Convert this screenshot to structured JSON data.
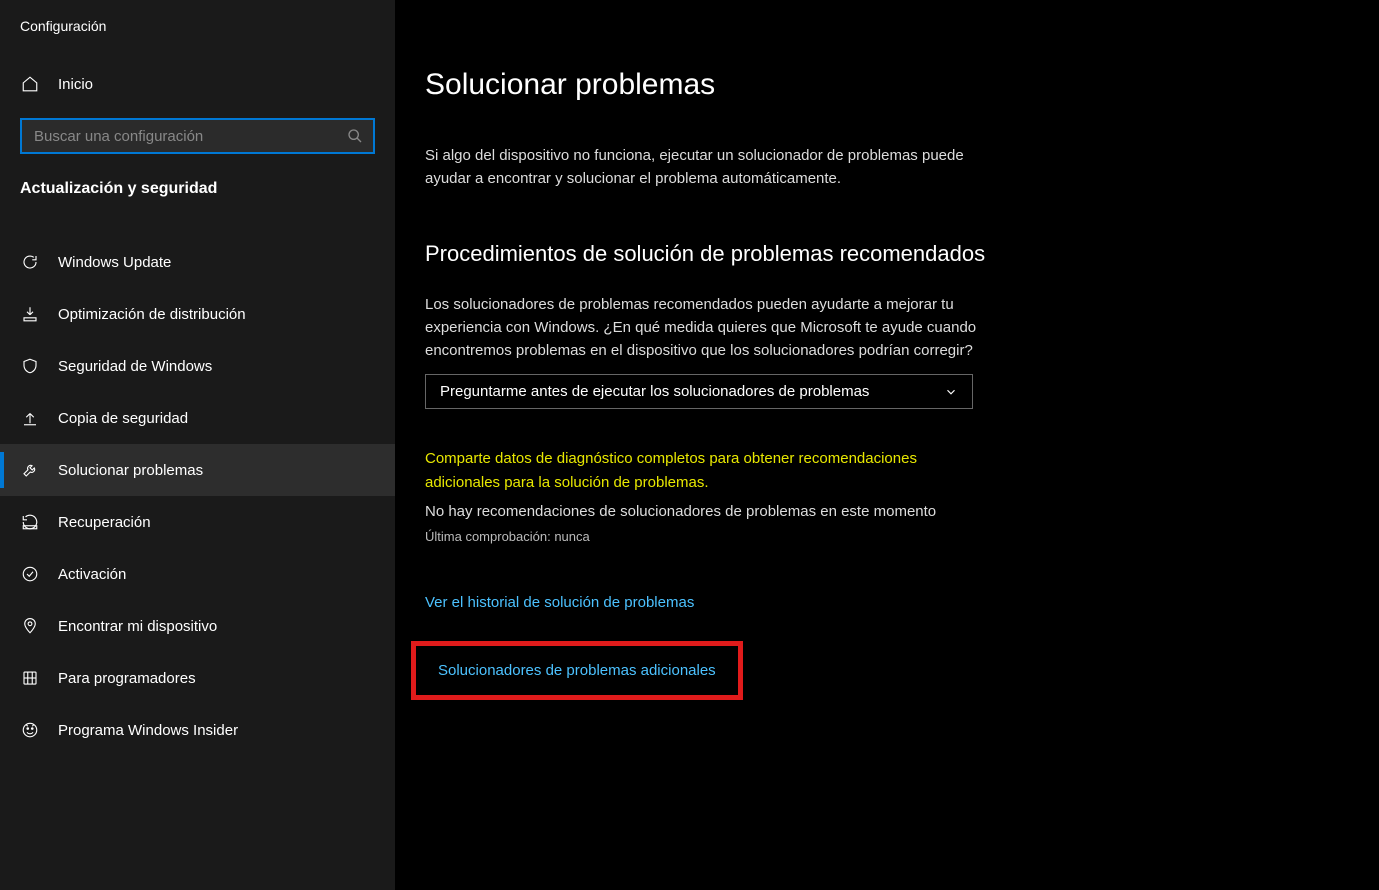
{
  "sidebar": {
    "header": "Configuración",
    "home_label": "Inicio",
    "search_placeholder": "Buscar una configuración",
    "section_title": "Actualización y seguridad",
    "items": [
      {
        "label": "Windows Update"
      },
      {
        "label": "Optimización de distribución"
      },
      {
        "label": "Seguridad de Windows"
      },
      {
        "label": "Copia de seguridad"
      },
      {
        "label": "Solucionar problemas"
      },
      {
        "label": "Recuperación"
      },
      {
        "label": "Activación"
      },
      {
        "label": "Encontrar mi dispositivo"
      },
      {
        "label": "Para programadores"
      },
      {
        "label": "Programa Windows Insider"
      }
    ]
  },
  "main": {
    "title": "Solucionar problemas",
    "description": "Si algo del dispositivo no funciona, ejecutar un solucionador de problemas puede ayudar a encontrar y solucionar el problema automáticamente.",
    "section_title": "Procedimientos de solución de problemas recomendados",
    "section_desc": "Los solucionadores de problemas recomendados pueden ayudarte a mejorar tu experiencia con Windows. ¿En qué medida quieres que Microsoft te ayude cuando encontremos problemas en el dispositivo que los solucionadores podrían corregir?",
    "dropdown_value": "Preguntarme antes de ejecutar los solucionadores de problemas",
    "warning": "Comparte datos de diagnóstico completos para obtener recomendaciones adicionales para la solución de problemas.",
    "no_recommendations": "No hay recomendaciones de solucionadores de problemas en este momento",
    "last_check": "Última comprobación: nunca",
    "history_link": "Ver el historial de solución de problemas",
    "additional_link": "Solucionadores de problemas adicionales"
  }
}
